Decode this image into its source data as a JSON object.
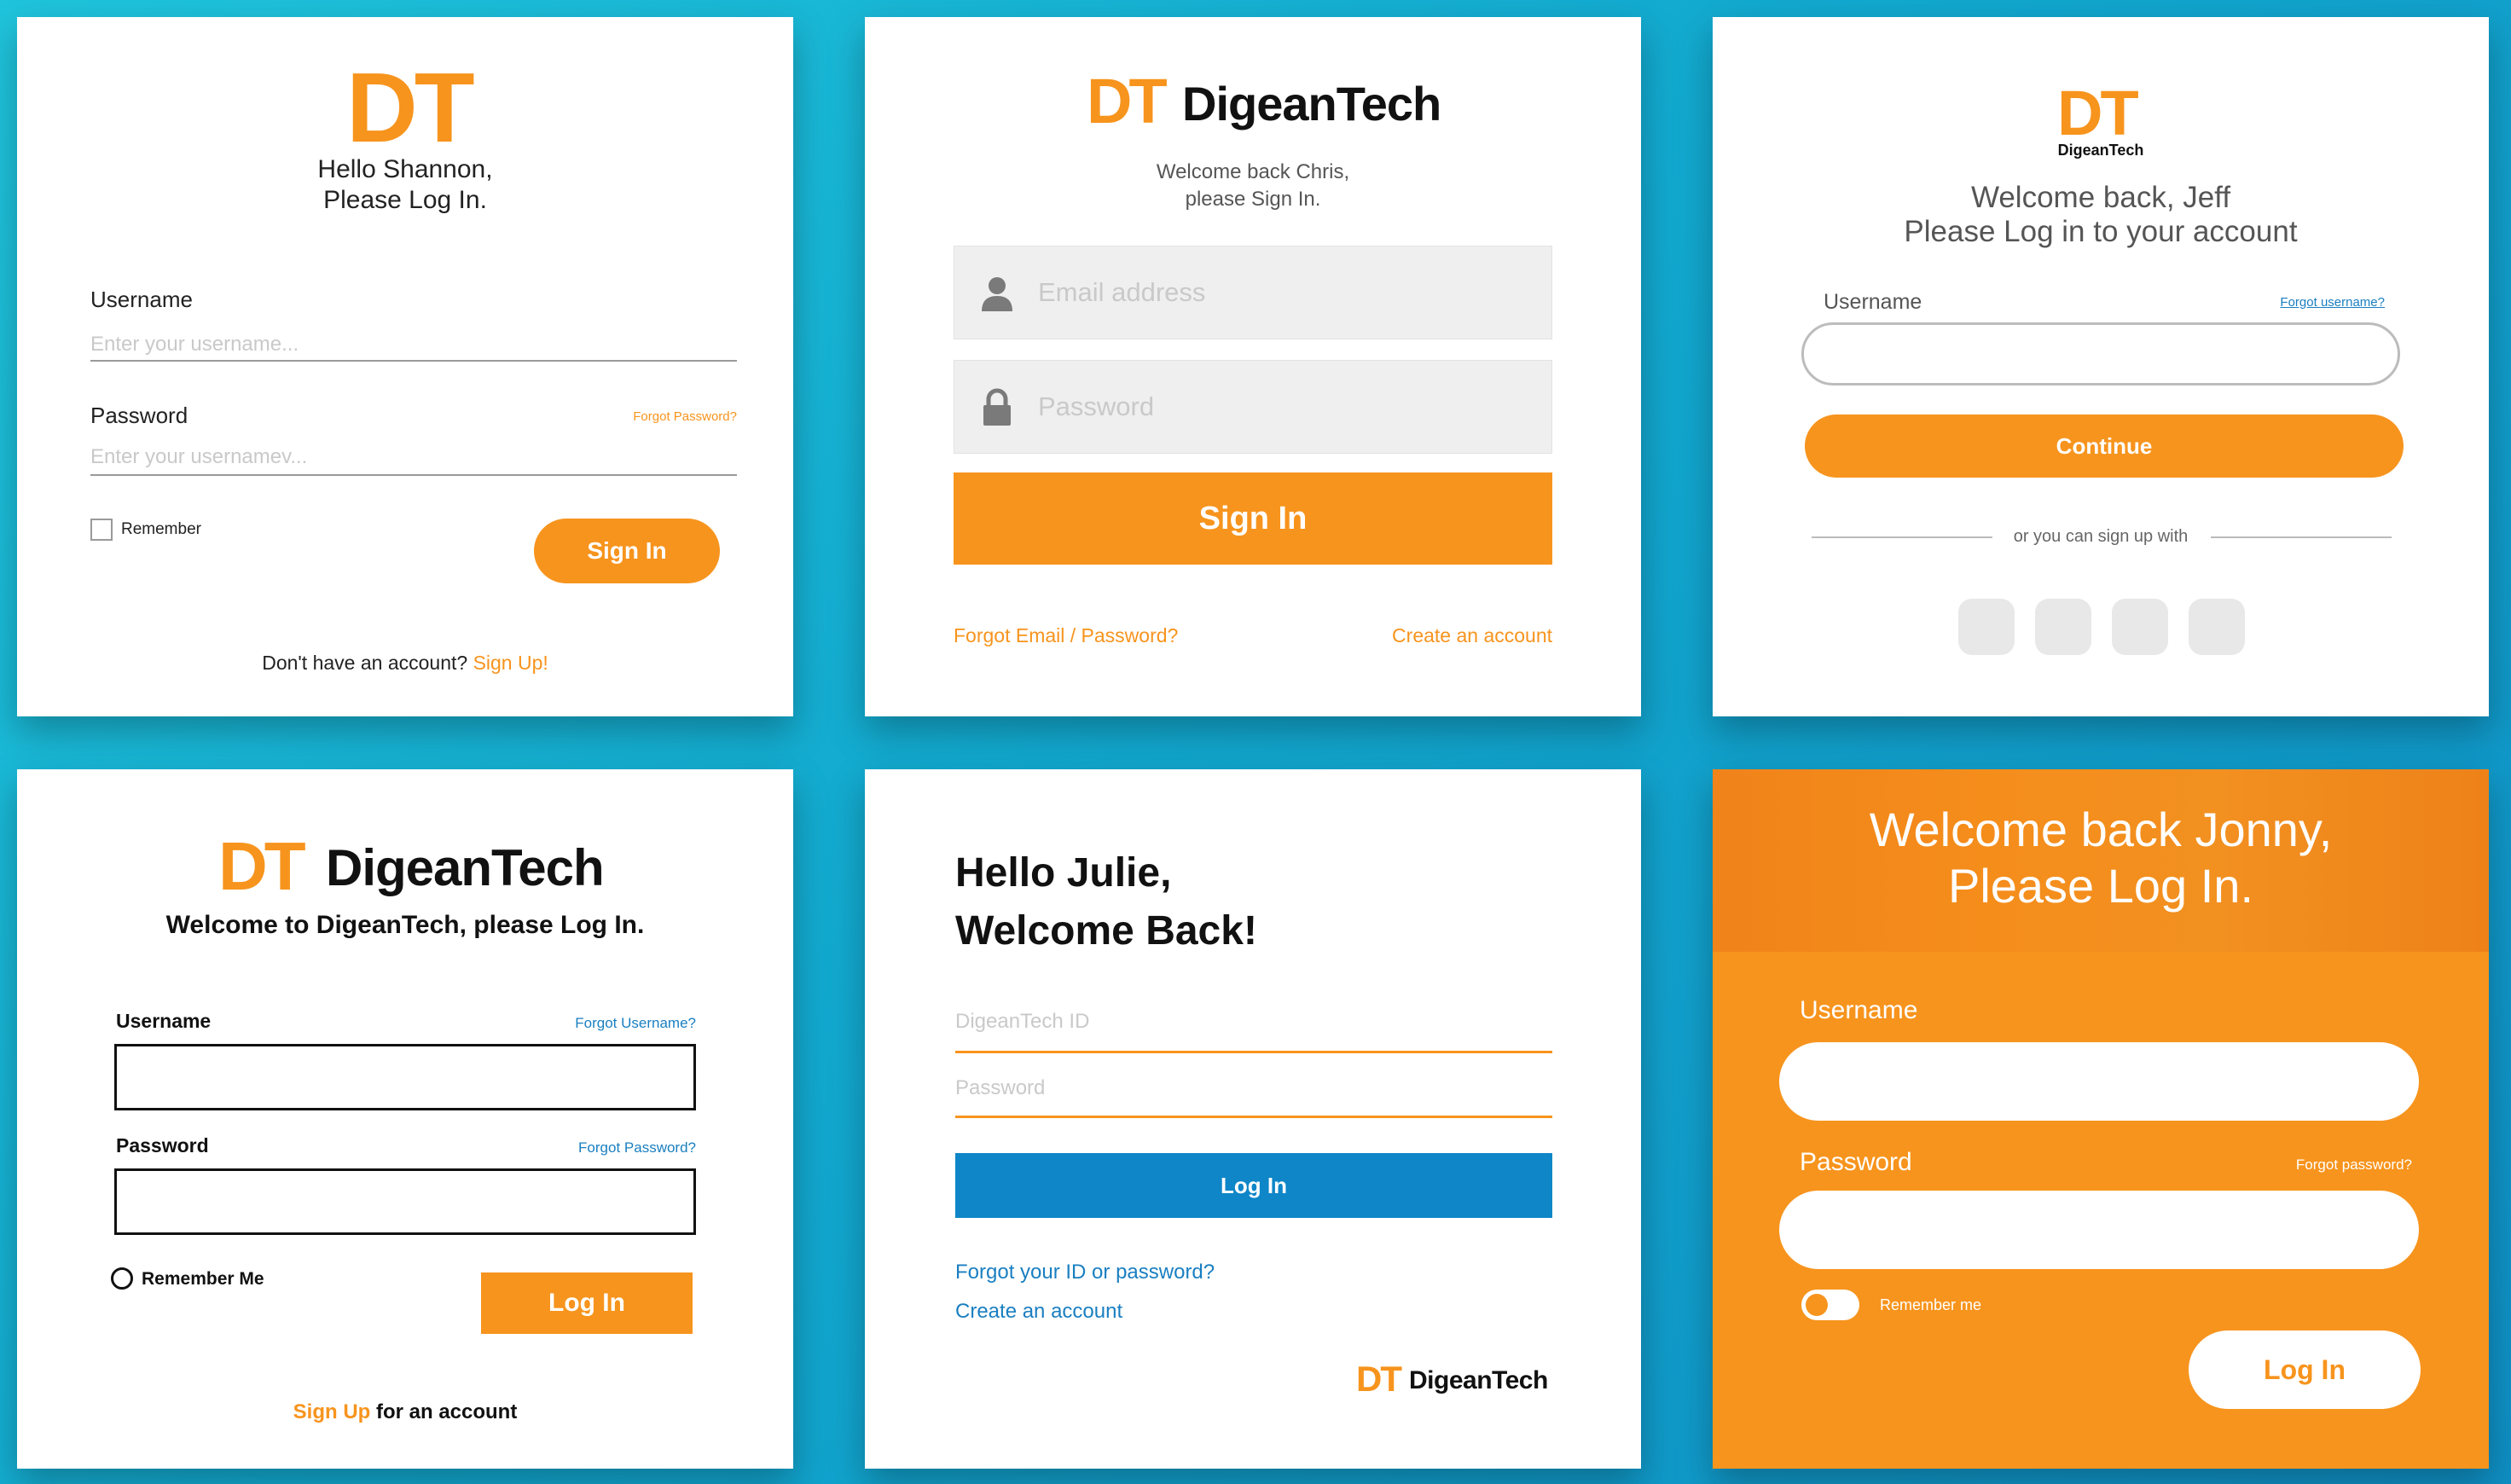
{
  "colors": {
    "accent": "#f7941d",
    "blue": "#0e86c8",
    "link": "#1a7fc1",
    "background": "#14b0d3"
  },
  "brand": {
    "logo_mark": "DT",
    "name": "DigeanTech"
  },
  "card1": {
    "greeting_line1": "Hello Shannon,",
    "greeting_line2": "Please Log In.",
    "username_label": "Username",
    "username_placeholder": "Enter your username...",
    "password_label": "Password",
    "forgot_password": "Forgot Password?",
    "password_placeholder": "Enter your usernamev...",
    "remember_label": "Remember",
    "signin_button": "Sign In",
    "no_account_text": "Don't have an account?",
    "signup_link": "Sign Up!"
  },
  "card2": {
    "welcome_line1": "Welcome back Chris,",
    "welcome_line2": "please Sign In.",
    "email_placeholder": "Email address",
    "email_icon": "user-icon",
    "password_placeholder": "Password",
    "password_icon": "lock-icon",
    "signin_button": "Sign In",
    "forgot_link": "Forgot Email / Password?",
    "create_link": "Create an account"
  },
  "card3": {
    "welcome_line1": "Welcome back, Jeff",
    "welcome_line2": "Please Log in to your account",
    "username_label": "Username",
    "forgot_username": "Forgot username?",
    "continue_button": "Continue",
    "divider_text": "or you can sign up with",
    "social_icons": [
      "social-icon-1",
      "social-icon-2",
      "social-icon-3",
      "social-icon-4"
    ]
  },
  "card4": {
    "welcome_text": "Welcome to DigeanTech, please Log In.",
    "username_label": "Username",
    "forgot_username": "Forgot Username?",
    "password_label": "Password",
    "forgot_password": "Forgot Password?",
    "remember_label": "Remember Me",
    "login_button": "Log In",
    "signup_link": "Sign Up",
    "signup_suffix": "for an account"
  },
  "card5": {
    "greeting_line1": "Hello Julie,",
    "greeting_line2": "Welcome Back!",
    "id_placeholder": "DigeanTech ID",
    "password_placeholder": "Password",
    "login_button": "Log In",
    "forgot_link": "Forgot your ID or password?",
    "create_link": "Create an account"
  },
  "card6": {
    "welcome_line1": "Welcome back Jonny,",
    "welcome_line2": "Please Log In.",
    "username_label": "Username",
    "password_label": "Password",
    "forgot_password": "Forgot password?",
    "remember_label": "Remember me",
    "login_button": "Log In"
  }
}
